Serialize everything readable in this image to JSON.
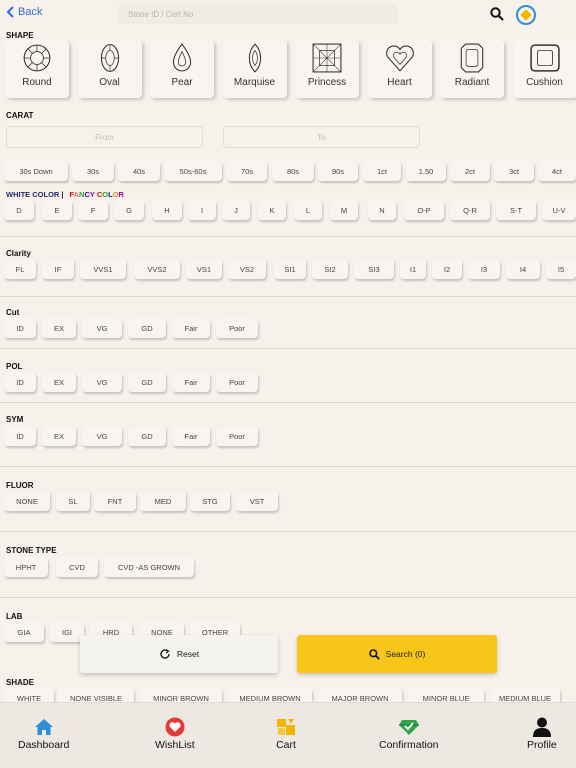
{
  "header": {
    "back_label": "Back",
    "search_placeholder": "Stone ID / Cert No"
  },
  "sections": {
    "shape": "SHAPE",
    "carat": "CARAT",
    "clarity": "Clarity",
    "cut": "Cut",
    "pol": "POL",
    "sym": "SYM",
    "fluor": "FLUOR",
    "stone_type": "STONE TYPE",
    "lab": "LAB",
    "shade": "SHADE"
  },
  "shapes": [
    "Round",
    "Oval",
    "Pear",
    "Marquise",
    "Princess",
    "Heart",
    "Radiant",
    "Cushion"
  ],
  "carat": {
    "from_placeholder": "From",
    "to_placeholder": "To",
    "ranges": [
      "30s Down",
      "30s",
      "40s",
      "50s-60s",
      "70s",
      "80s",
      "90s",
      "1ct",
      "1.50",
      "2ct",
      "3ct",
      "4ct"
    ]
  },
  "color_header": {
    "white": "WHITE COLOR",
    "sep": "|",
    "fancy_parts": [
      "F",
      "A",
      "N",
      "C",
      "Y",
      " ",
      "C",
      "O",
      "L",
      "O",
      "R"
    ],
    "fancy_colors": [
      "#d11",
      "#e67",
      "#2a2",
      "#21c",
      "#a0a",
      "#000",
      "#d11",
      "#2a2",
      "#21c",
      "#e80",
      "#a0a"
    ]
  },
  "colors": [
    "D",
    "E",
    "F",
    "G",
    "H",
    "I",
    "J",
    "K",
    "L",
    "M",
    "N",
    "O-P",
    "Q-R",
    "S-T",
    "U-V"
  ],
  "clarity": [
    "FL",
    "IF",
    "VVS1",
    "VVS2",
    "VS1",
    "VS2",
    "SI1",
    "SI2",
    "SI3",
    "I1",
    "I2",
    "I3",
    "I4",
    "I5"
  ],
  "cut": [
    "ID",
    "EX",
    "VG",
    "GD",
    "Fair",
    "Poor"
  ],
  "pol": [
    "ID",
    "EX",
    "VG",
    "GD",
    "Fair",
    "Poor"
  ],
  "sym": [
    "ID",
    "EX",
    "VG",
    "GD",
    "Fair",
    "Poor"
  ],
  "fluor": [
    "NONE",
    "SL",
    "FNT",
    "MED",
    "STG",
    "VST"
  ],
  "stone_type": [
    "HPHT",
    "CVD",
    "CVD -AS GROWN"
  ],
  "lab": [
    "GIA",
    "IGI",
    "HRD",
    "NONE",
    "OTHER"
  ],
  "shade": [
    "WHITE",
    "NONE VISIBLE",
    "MINOR BROWN",
    "MEDIUM BROWN",
    "MAJOR BROWN",
    "MINOR BLUE",
    "MEDIUM BLUE"
  ],
  "actions": {
    "reset_label": "Reset",
    "search_label": "Search (0)"
  },
  "bottom_nav": [
    "Dashboard",
    "WishList",
    "Cart",
    "Confirmation",
    "Profile"
  ],
  "colors_theme": {
    "accent": "#f8c519",
    "link": "#2f6fd6",
    "background": "#f7f1ec"
  }
}
